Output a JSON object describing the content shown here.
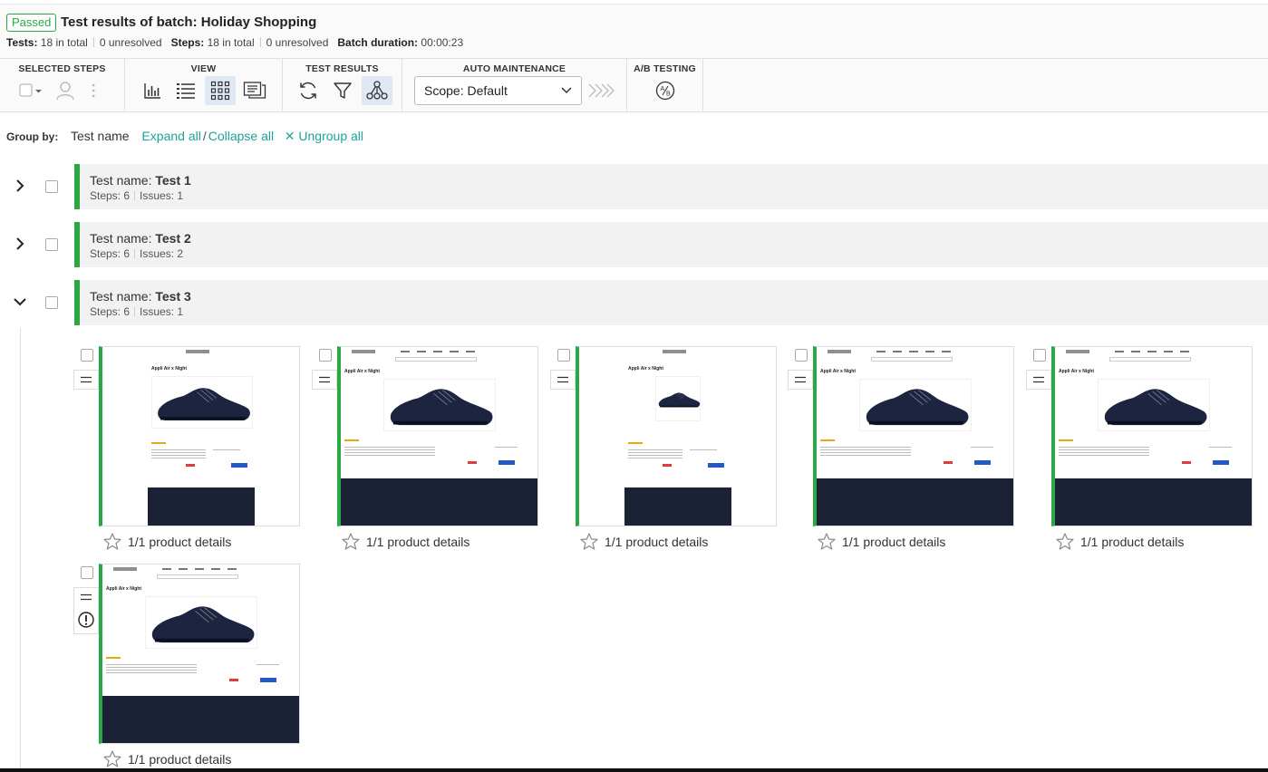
{
  "header": {
    "status": "Passed",
    "title": "Test results of batch: Holiday Shopping",
    "tests_label": "Tests:",
    "tests_total": "18 in total",
    "tests_unresolved": "0 unresolved",
    "steps_label": "Steps:",
    "steps_total": "18 in total",
    "steps_unresolved": "0 unresolved",
    "duration_label": "Batch duration:",
    "duration_value": "00:00:23"
  },
  "toolbar": {
    "selected_steps": "SELECTED STEPS",
    "view": "VIEW",
    "test_results": "TEST RESULTS",
    "auto_maintenance": "AUTO MAINTENANCE",
    "ab_testing": "A/B TESTING",
    "scope": "Scope: Default",
    "active_view": "grid-view",
    "active_result_tool": "branches"
  },
  "groupby": {
    "label": "Group by:",
    "value": "Test name",
    "expand_all": "Expand all",
    "separator": "/",
    "collapse_all": "Collapse all",
    "ungroup_all": "Ungroup all"
  },
  "groups": [
    {
      "prefix": "Test name: ",
      "name": "Test 1",
      "steps": "Steps: 6",
      "issues": "Issues: 1",
      "expanded": false
    },
    {
      "prefix": "Test name: ",
      "name": "Test 2",
      "steps": "Steps: 6",
      "issues": "Issues: 2",
      "expanded": false
    },
    {
      "prefix": "Test name: ",
      "name": "Test 3",
      "steps": "Steps: 6",
      "issues": "Issues: 1",
      "expanded": true
    }
  ],
  "steps": [
    {
      "caption": "1/1 product details",
      "title": "Appli Air x Night"
    },
    {
      "caption": "1/1 product details",
      "title": "Appli Air x Night"
    },
    {
      "caption": "1/1 product details",
      "title": "Appli Air x Night"
    },
    {
      "caption": "1/1 product details",
      "title": "Appli Air x Night"
    },
    {
      "caption": "1/1 product details",
      "title": "Appli Air x Night"
    },
    {
      "caption": "1/1 product details",
      "title": "Appli Air x Night"
    }
  ],
  "colors": {
    "accent": "#2aa846",
    "link": "#1ea39a",
    "selected": "#dfe8f3",
    "footer": "#1b2236"
  }
}
